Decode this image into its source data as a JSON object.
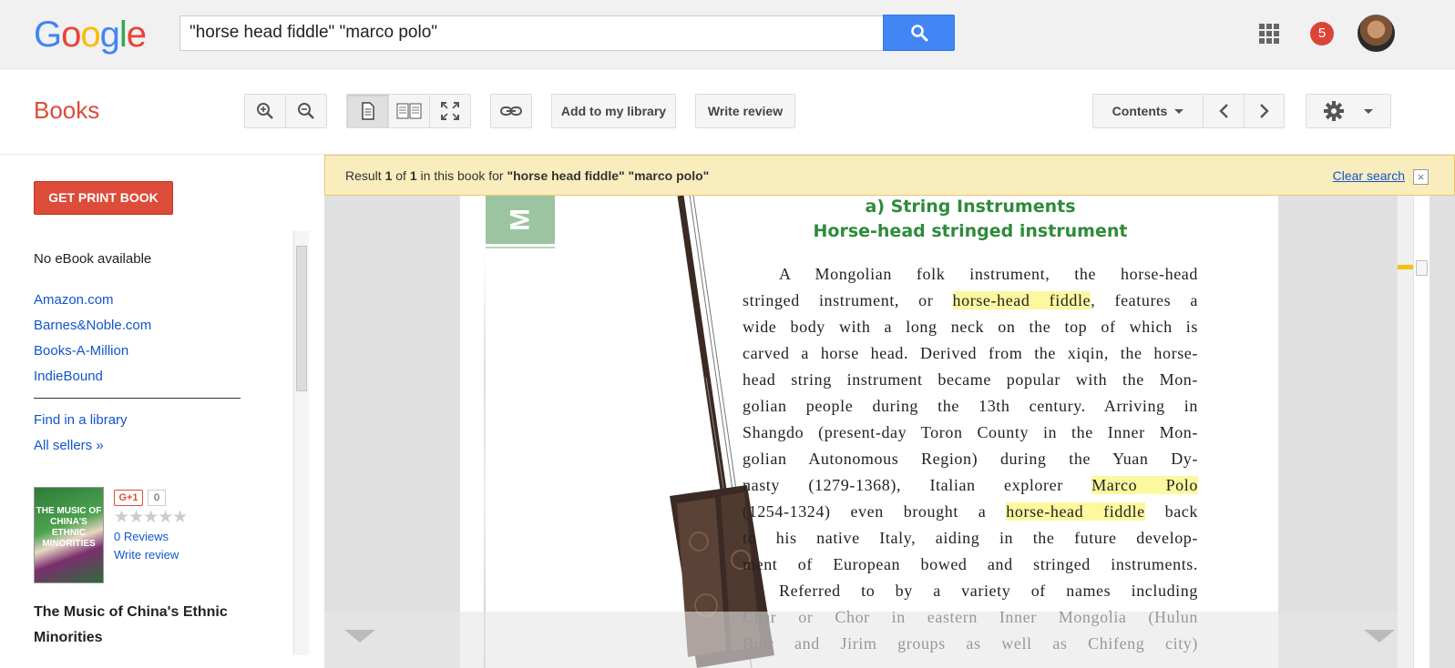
{
  "header": {
    "logo": [
      "G",
      "o",
      "o",
      "g",
      "l",
      "e"
    ],
    "search_value": "\"horse head fiddle\" \"marco polo\"",
    "notifications": "5"
  },
  "toolbar": {
    "section_title": "Books",
    "add_library": "Add to my library",
    "write_review": "Write review",
    "contents": "Contents"
  },
  "sidebar": {
    "get_print": "GET PRINT BOOK",
    "no_ebook": "No eBook available",
    "sellers": [
      "Amazon.com",
      "Barnes&Noble.com",
      "Books-A-Million",
      "IndieBound"
    ],
    "find_library": "Find in a library",
    "all_sellers": "All sellers »",
    "cover_text": "THE MUSIC OF CHINA'S ETHNIC MINORITIES",
    "gplus": "G+1",
    "gplus_count": "0",
    "stars": "★★★★★",
    "reviews": "0 Reviews",
    "write_review": "Write review",
    "book_title": "The Music of China's Ethnic Minorities"
  },
  "result_bar": {
    "prefix": "Result ",
    "index": "1",
    "of": " of ",
    "total": "1",
    "middle": " in this book for ",
    "query": "\"horse head fiddle\" \"marco polo\"",
    "clear": "Clear search",
    "close": "×"
  },
  "page": {
    "tab_letter": "M",
    "heading1": "a) String Instruments",
    "heading2": "Horse-head stringed instrument",
    "lines": [
      {
        "pre": "A Mongolian folk instrument, the horse-head",
        "hl": "",
        "post": ""
      },
      {
        "pre": "stringed instrument, or ",
        "hl": "horse-head fiddle",
        "post": ", features a"
      },
      {
        "pre": "wide body with a long neck on the top of which is",
        "hl": "",
        "post": ""
      },
      {
        "pre": "carved a horse head. Derived from the xiqin, the horse-",
        "hl": "",
        "post": ""
      },
      {
        "pre": "head string instrument became popular with the Mon-",
        "hl": "",
        "post": ""
      },
      {
        "pre": "golian people during the 13th century. Arriving in",
        "hl": "",
        "post": ""
      },
      {
        "pre": "Shangdo (present-day Toron County in the Inner Mon-",
        "hl": "",
        "post": ""
      },
      {
        "pre": "golian Autonomous Region) during the Yuan Dy-",
        "hl": "",
        "post": ""
      },
      {
        "pre": "nasty (1279-1368), Italian explorer ",
        "hl": "Marco Polo",
        "post": ""
      },
      {
        "pre": "(1254-1324) even brought a ",
        "hl": "horse-head fiddle",
        "post": " back"
      },
      {
        "pre": "to his native Italy, aiding in the future develop-",
        "hl": "",
        "post": ""
      },
      {
        "pre": "ment of European bowed and stringed instruments.",
        "hl": "",
        "post": ""
      },
      {
        "pre": "Referred to by a variety of names including",
        "hl": "",
        "post": ""
      },
      {
        "pre": "Char or Chor in eastern Inner Mongolia (Hulun",
        "hl": "",
        "post": ""
      },
      {
        "pre": "Buir and Jirim groups as well as Chifeng city)",
        "hl": "",
        "post": ""
      }
    ]
  }
}
